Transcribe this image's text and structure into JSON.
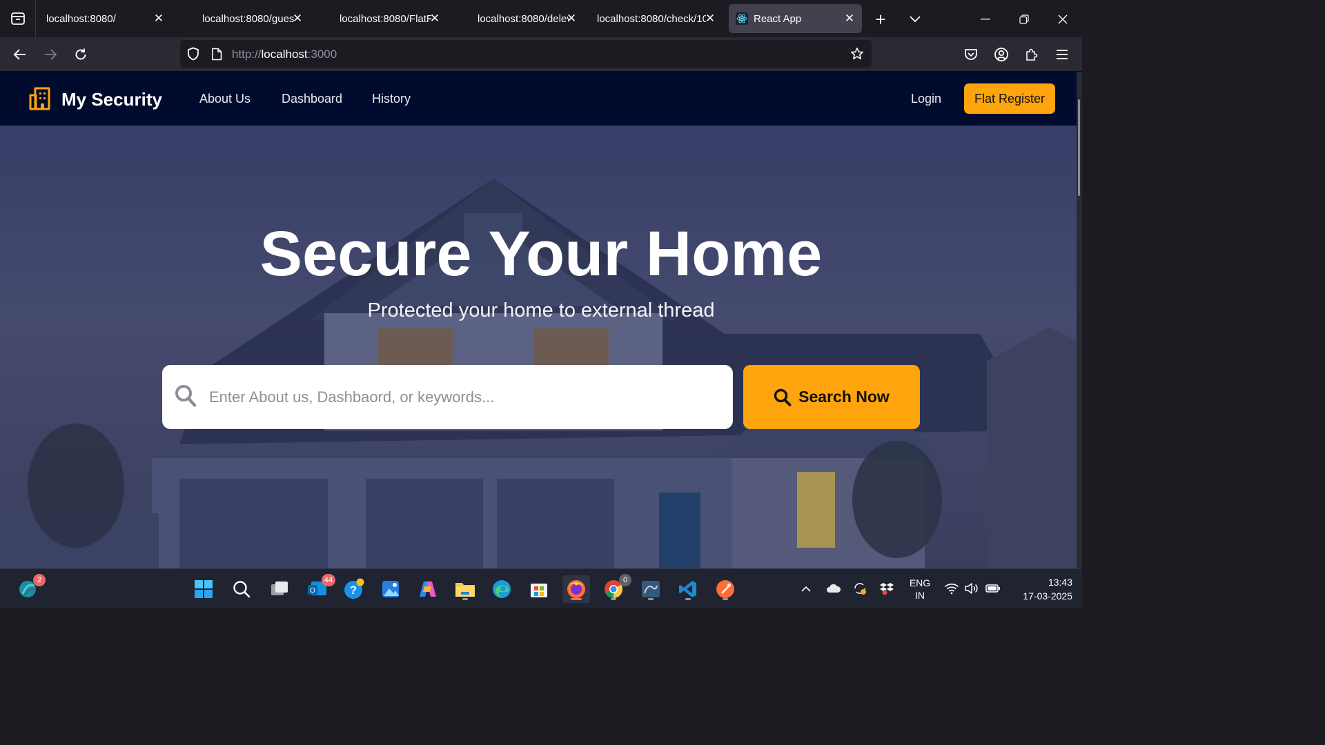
{
  "browser": {
    "tabs": [
      {
        "title": "localhost:8080/",
        "active": false
      },
      {
        "title": "localhost:8080/gues",
        "active": false
      },
      {
        "title": "localhost:8080/FlatR",
        "active": false
      },
      {
        "title": "localhost:8080/delev",
        "active": false
      },
      {
        "title": "localhost:8080/check/10",
        "active": false
      },
      {
        "title": "React App",
        "active": true
      }
    ],
    "url_prefix": "http://",
    "url_host": "localhost",
    "url_port": ":3000"
  },
  "site": {
    "brand": "My Security",
    "nav": [
      "About Us",
      "Dashboard",
      "History"
    ],
    "login": "Login",
    "register": "Flat Register"
  },
  "hero": {
    "title": "Secure Your Home",
    "subtitle": "Protected your home to external thread",
    "search_placeholder": "Enter About us, Dashbaord, or keywords...",
    "search_button": "Search Now"
  },
  "colors": {
    "accent": "#ffa40d",
    "nav_bg": "#010b2d"
  },
  "taskbar": {
    "widgets_badge": "2",
    "mail_badge": "44",
    "chrome_badge": "0",
    "language_line1": "ENG",
    "language_line2": "IN",
    "time": "13:43",
    "date": "17-03-2025"
  }
}
